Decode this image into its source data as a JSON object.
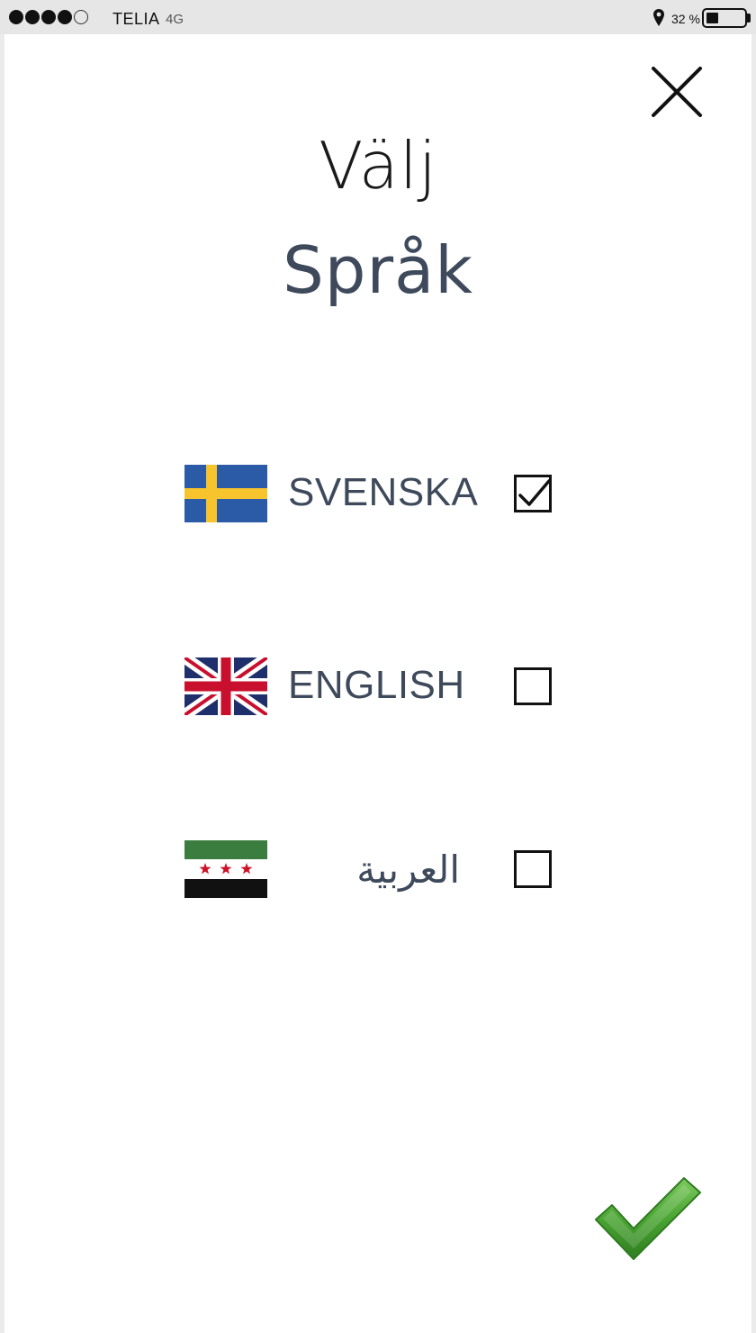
{
  "status_bar": {
    "signal_bars": 5,
    "signal_filled": 4,
    "carrier": "TELIA",
    "network": "4G",
    "location_icon": "location-pin-icon",
    "battery_percent_label": "32 %",
    "battery_level": 0.32
  },
  "header": {
    "close_icon": "close-icon",
    "title_line1": "Välj",
    "title_line2": "Språk"
  },
  "languages": [
    {
      "label": "SVENSKA",
      "flag": "sweden-flag-icon",
      "checked": true
    },
    {
      "label": "ENGLISH",
      "flag": "uk-flag-icon",
      "checked": false
    },
    {
      "label": "العربية",
      "flag": "syria-flag-icon",
      "checked": false
    }
  ],
  "footer": {
    "confirm_icon": "green-checkmark-icon"
  },
  "colors": {
    "title_dark": "#1a1a1a",
    "accent_text": "#3e4a5b",
    "sweden_blue": "#2b5aa7",
    "sweden_yellow": "#f7c42d",
    "uk_blue": "#1f2f6b",
    "uk_red": "#c8102e",
    "syria_green": "#3a7d3f",
    "syria_red": "#ce1126",
    "confirm_green": "#3e9a2e"
  }
}
